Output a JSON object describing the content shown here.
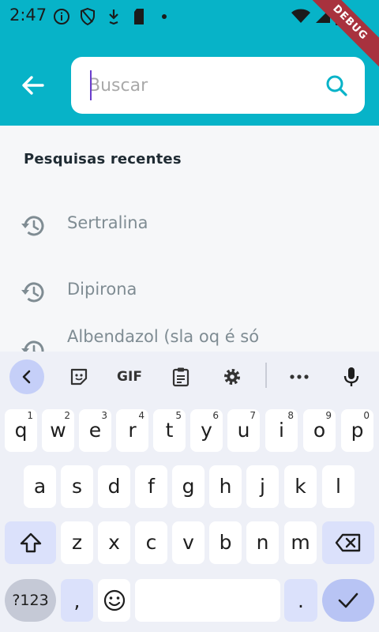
{
  "status_bar": {
    "time": "2:47"
  },
  "debug_ribbon": "DEBUG",
  "search": {
    "placeholder": "Buscar",
    "value": ""
  },
  "recent": {
    "title": "Pesquisas recentes",
    "items": [
      "Sertralina",
      "Dipirona",
      "Albendazol (sla oq é só"
    ]
  },
  "keyboard": {
    "toolbar": {
      "gif_label": "GIF"
    },
    "row1": [
      {
        "k": "q",
        "h": "1"
      },
      {
        "k": "w",
        "h": "2"
      },
      {
        "k": "e",
        "h": "3"
      },
      {
        "k": "r",
        "h": "4"
      },
      {
        "k": "t",
        "h": "5"
      },
      {
        "k": "y",
        "h": "6"
      },
      {
        "k": "u",
        "h": "7"
      },
      {
        "k": "i",
        "h": "8"
      },
      {
        "k": "o",
        "h": "9"
      },
      {
        "k": "p",
        "h": "0"
      }
    ],
    "row2": [
      "a",
      "s",
      "d",
      "f",
      "g",
      "h",
      "j",
      "k",
      "l"
    ],
    "row3": [
      "z",
      "x",
      "c",
      "v",
      "b",
      "n",
      "m"
    ],
    "symbols_label": "?123",
    "comma": ",",
    "period": "."
  },
  "colors": {
    "accent": "#07b3c8",
    "keyboard_bg": "#eef0f7",
    "function_key": "#dbe1fb",
    "debug": "#a8323e"
  }
}
